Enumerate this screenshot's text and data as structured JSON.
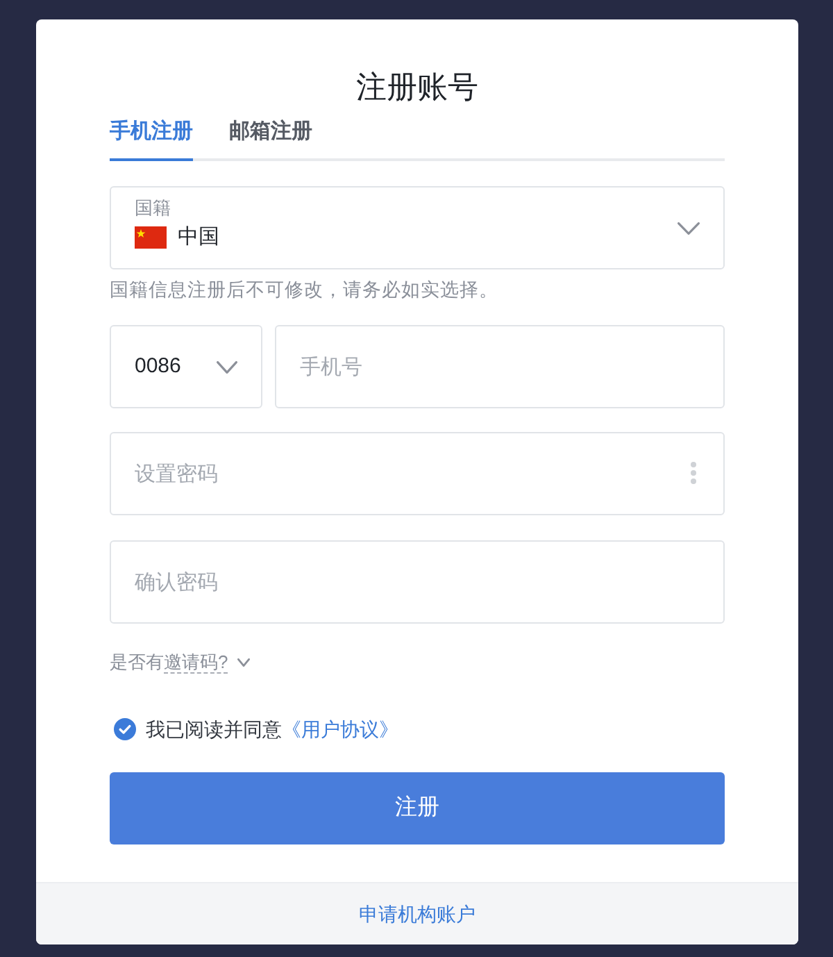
{
  "title": "注册账号",
  "tabs": [
    {
      "label": "手机注册",
      "selected": true
    },
    {
      "label": "邮箱注册",
      "selected": false
    }
  ],
  "nationality": {
    "label": "国籍",
    "value": "中国",
    "hint": "国籍信息注册后不可修改，请务必如实选择。"
  },
  "phone": {
    "country_code": "0086",
    "placeholder": "手机号"
  },
  "password": {
    "placeholder": "设置密码"
  },
  "confirm_password": {
    "placeholder": "确认密码"
  },
  "invite": {
    "prefix": "是否有",
    "link": "邀请码?",
    "expanded": false
  },
  "agreement": {
    "checked": true,
    "text": "我已阅读并同意",
    "link": "《用户协议》"
  },
  "submit_button": "注册",
  "footer_link": "申请机构账户"
}
